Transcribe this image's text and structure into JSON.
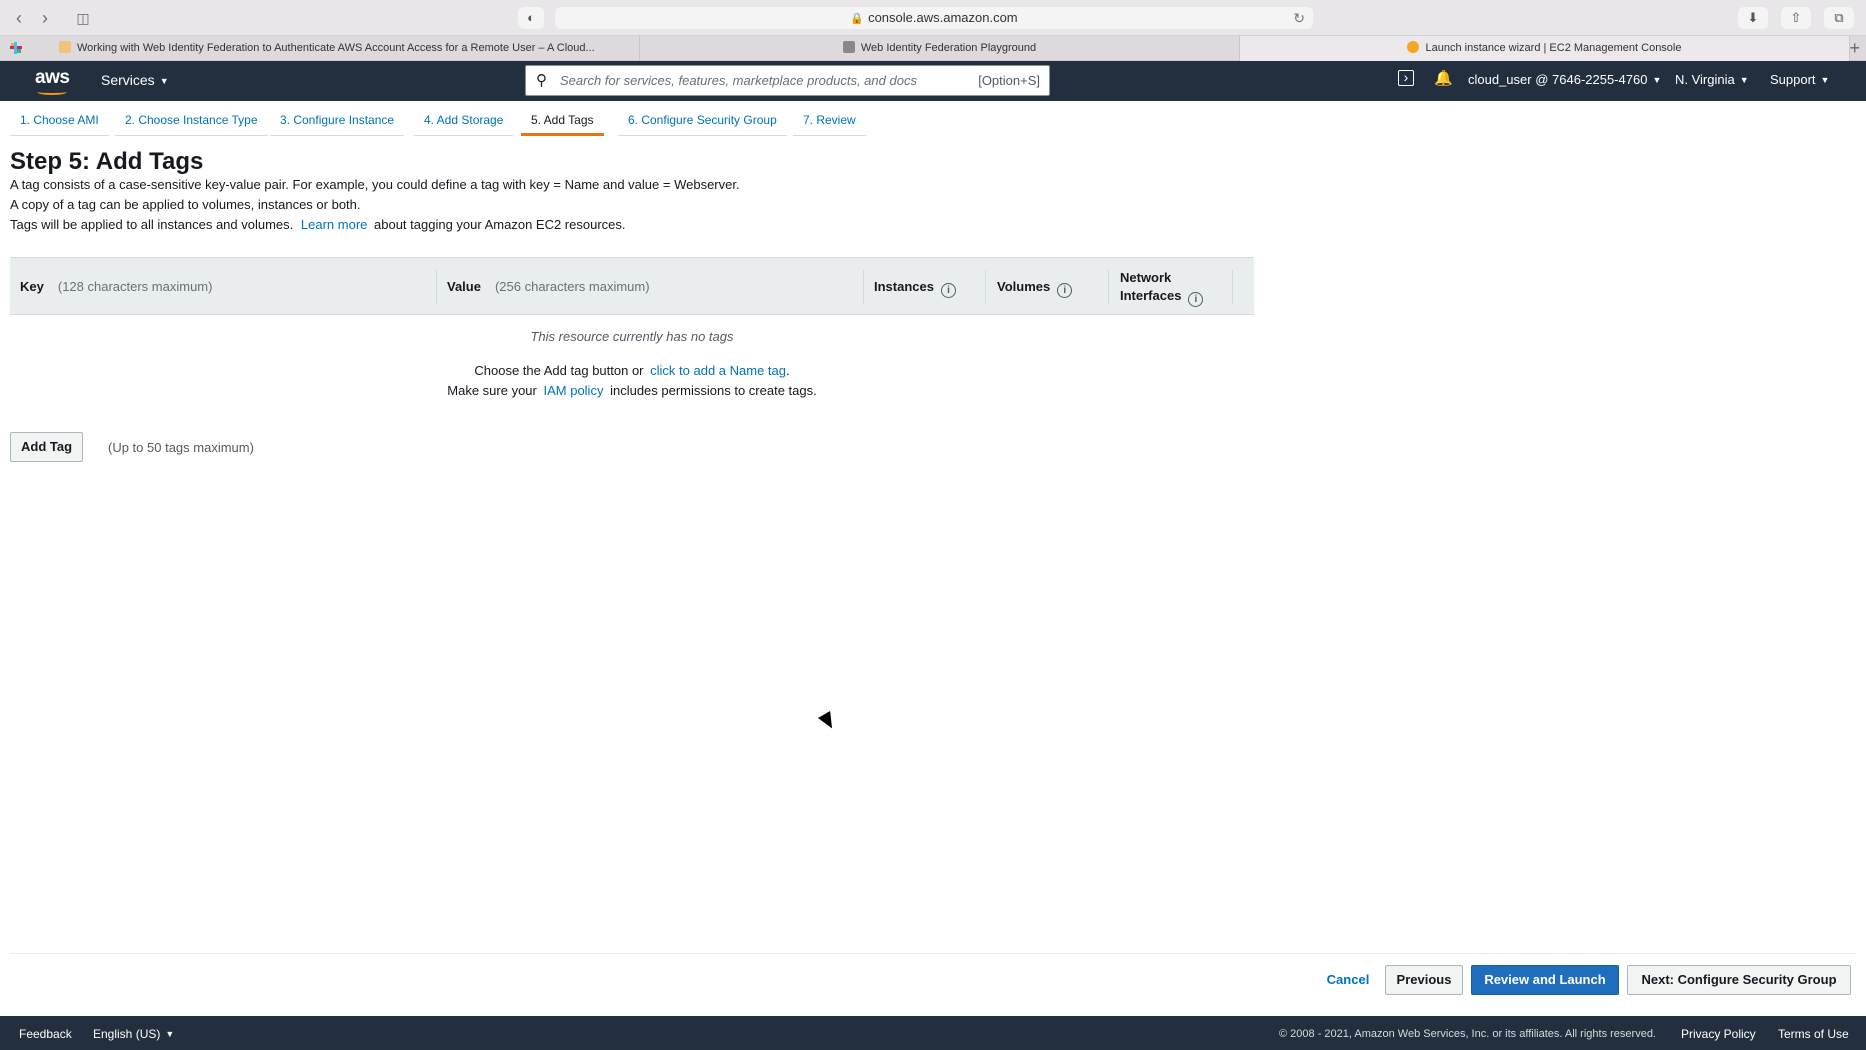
{
  "browser": {
    "url": "console.aws.amazon.com",
    "tabs": [
      {
        "title": "Working with Web Identity Federation to Authenticate AWS Account Access for a Remote User – A Cloud..."
      },
      {
        "title": "Web Identity Federation Playground"
      },
      {
        "title": "Launch instance wizard | EC2 Management Console"
      }
    ]
  },
  "header": {
    "logo": "aws",
    "services_label": "Services",
    "search_placeholder": "Search for services, features, marketplace products, and docs",
    "search_shortcut": "[Option+S]",
    "account": "cloud_user @ 7646-2255-4760",
    "region": "N. Virginia",
    "support": "Support"
  },
  "wizard": {
    "steps": [
      "1. Choose AMI",
      "2. Choose Instance Type",
      "3. Configure Instance",
      "4. Add Storage",
      "5. Add Tags",
      "6. Configure Security Group",
      "7. Review"
    ],
    "active_step": 4
  },
  "page": {
    "title": "Step 5: Add Tags",
    "desc1": "A tag consists of a case-sensitive key-value pair. For example, you could define a tag with key = Name and value = Webserver.",
    "desc2": "A copy of a tag can be applied to volumes, instances or both.",
    "desc3_pre": "Tags will be applied to all instances and volumes.",
    "desc3_link": "Learn more",
    "desc3_post": "about tagging your Amazon EC2 resources."
  },
  "table": {
    "key_label": "Key",
    "key_hint": "(128 characters maximum)",
    "value_label": "Value",
    "value_hint": "(256 characters maximum)",
    "instances_label": "Instances",
    "volumes_label": "Volumes",
    "network_label_1": "Network",
    "network_label_2": "Interfaces",
    "empty_title": "This resource currently has no tags",
    "empty_line1_pre": "Choose the Add tag button or",
    "empty_line1_link": "click to add a Name tag",
    "empty_line1_post": ".",
    "empty_line2_pre": "Make sure your",
    "empty_line2_link": "IAM policy",
    "empty_line2_post": "includes permissions to create tags."
  },
  "actions": {
    "add_tag": "Add Tag",
    "add_tag_hint": "(Up to 50 tags maximum)",
    "cancel": "Cancel",
    "previous": "Previous",
    "review_launch": "Review and Launch",
    "next": "Next: Configure Security Group"
  },
  "footer": {
    "feedback": "Feedback",
    "language": "English (US)",
    "copyright": "© 2008 - 2021, Amazon Web Services, Inc. or its affiliates. All rights reserved.",
    "privacy": "Privacy Policy",
    "terms": "Terms of Use"
  },
  "colors": {
    "header_bg": "#232f3e",
    "link": "#0073bb",
    "primary_button": "#1f6ebd",
    "active_step_underline": "#ec7211"
  }
}
